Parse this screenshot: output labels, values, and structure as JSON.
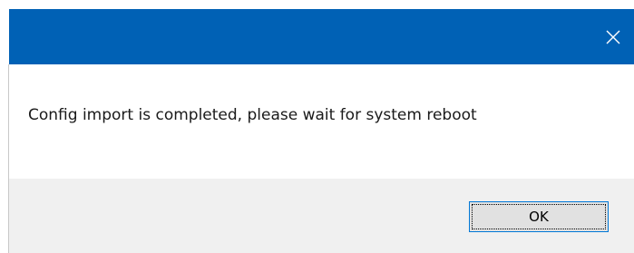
{
  "dialog": {
    "message": "Config import is completed, please wait for system reboot",
    "ok_label": "OK",
    "close_icon": "close-icon"
  },
  "colors": {
    "titlebar": "#0061b5",
    "footer": "#f0f0f0",
    "button_border": "#0078d7"
  }
}
